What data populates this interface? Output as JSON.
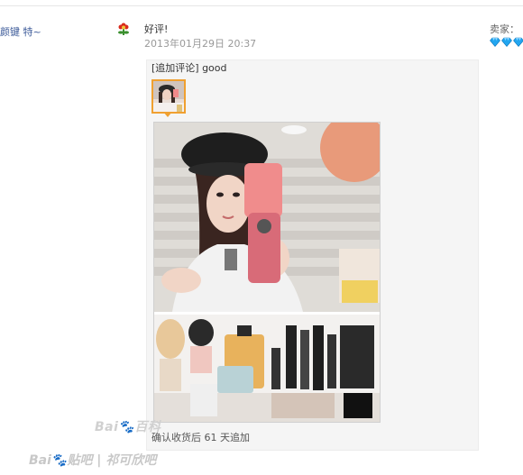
{
  "buyer": {
    "name": "颜键 特~"
  },
  "review": {
    "rating_label": "好评!",
    "timestamp": "2013年01月29日 20:37",
    "followup": {
      "comment": "[追加评论] good",
      "time_note": "确认收货后 61 天追加"
    }
  },
  "seller": {
    "label": "卖家："
  },
  "watermark": {
    "center": "Bai🐾百科",
    "bottom": "Bai🐾贴吧 | 祁可欣吧"
  },
  "icons": {
    "rating": "red-flower-icon",
    "seller_level": "blue-diamond-icon"
  },
  "colors": {
    "thumb_border": "#f0a030",
    "diamond": "#22a6f0",
    "link": "#3b5998"
  }
}
